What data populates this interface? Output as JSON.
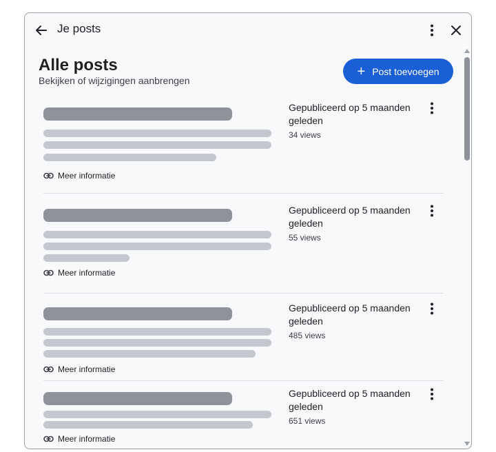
{
  "header": {
    "title": "Je posts",
    "back_icon": "arrow-back-icon",
    "more_icon": "more-vert-icon",
    "close_icon": "close-icon"
  },
  "main": {
    "title": "Alle posts",
    "subtitle": "Bekijken of wijzigingen aanbrengen",
    "add_button": {
      "icon": "plus-icon",
      "label": "Post toevoegen"
    }
  },
  "posts": [
    {
      "published": "Gepubliceerd op 5 maanden geleden",
      "views": "34 views",
      "link_label": "Meer informatie"
    },
    {
      "published": "Gepubliceerd op 5 maanden geleden",
      "views": "55 views",
      "link_label": "Meer informatie"
    },
    {
      "published": "Gepubliceerd op 5 maanden geleden",
      "views": "485 views",
      "link_label": "Meer informatie"
    },
    {
      "published": "Gepubliceerd op 5 maanden geleden",
      "views": "651 views",
      "link_label": "Meer informatie"
    }
  ],
  "colors": {
    "accent": "#1a5fd6",
    "placeholder_title": "#8e939b",
    "placeholder_line": "#c3c7ce",
    "dialog_bg": "#f8f9fa"
  }
}
